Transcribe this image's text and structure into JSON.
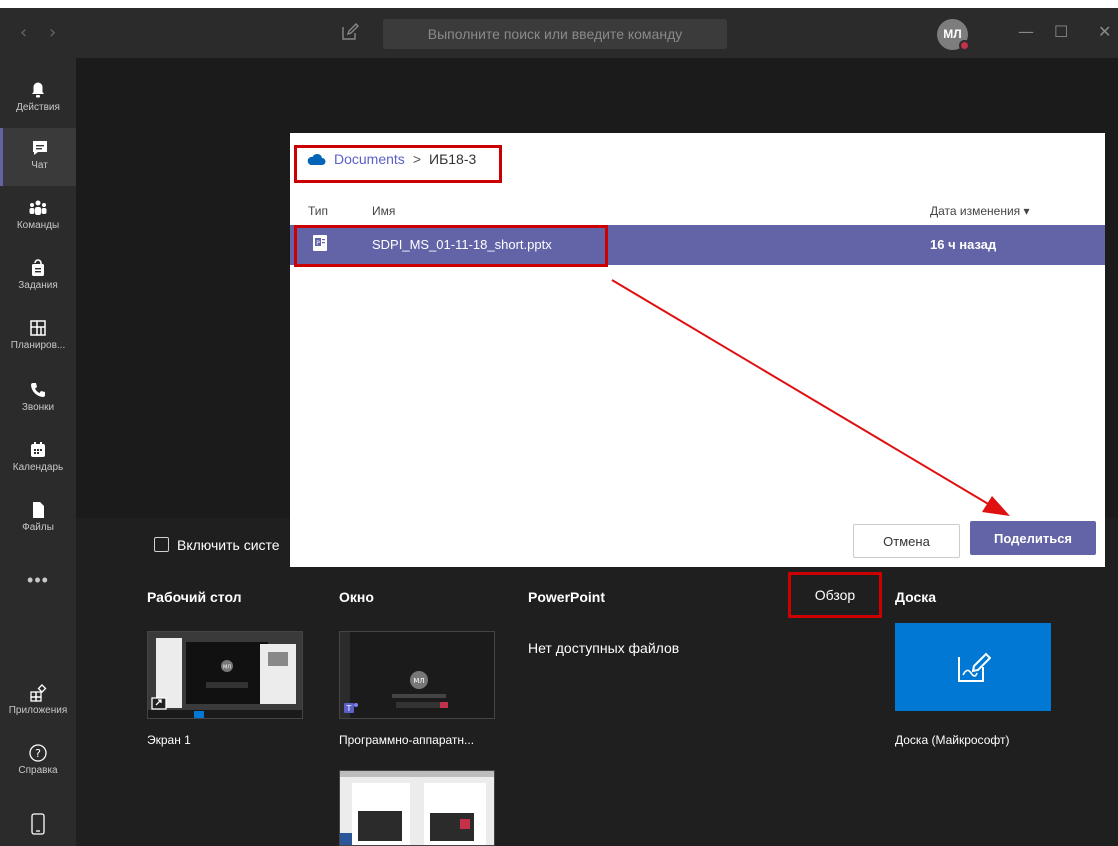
{
  "titlebar": {
    "back": "‹",
    "forward": "›",
    "search_placeholder": "Выполните поиск или введите команду",
    "avatar_initials": "МЛ",
    "minimize": "—",
    "maximize": "☐",
    "close": "✕"
  },
  "rail": {
    "items": [
      {
        "label": "Действия",
        "icon": "bell-icon"
      },
      {
        "label": "Чат",
        "icon": "chat-icon"
      },
      {
        "label": "Команды",
        "icon": "teams-icon"
      },
      {
        "label": "Задания",
        "icon": "assignments-icon"
      },
      {
        "label": "Планиров...",
        "icon": "planner-icon"
      },
      {
        "label": "Звонки",
        "icon": "phone-icon"
      },
      {
        "label": "Календарь",
        "icon": "calendar-icon"
      },
      {
        "label": "Файлы",
        "icon": "file-icon"
      },
      {
        "label": "Приложения",
        "icon": "apps-icon"
      },
      {
        "label": "Справка",
        "icon": "help-icon"
      }
    ],
    "more": "•••"
  },
  "share_tray": {
    "system_audio_label": "Включить систе",
    "columns": {
      "desktop": "Рабочий стол",
      "window": "Окно",
      "powerpoint": "PowerPoint",
      "browse": "Обзор",
      "whiteboard": "Доска"
    },
    "no_files": "Нет доступных файлов",
    "desktop_thumb_label": "Экран 1",
    "window_thumb_label": "Программно-аппаратн...",
    "whiteboard_label": "Доска (Майкрософт)",
    "thumb_avatar": "МЛ"
  },
  "dialog": {
    "breadcrumb": {
      "root": "Documents",
      "separator": ">",
      "current": "ИБ18-3"
    },
    "columns": {
      "type": "Тип",
      "name": "Имя",
      "modified": "Дата изменения ▾"
    },
    "files": [
      {
        "name": "SDPI_MS_01-11-18_short.pptx",
        "modified": "16 ч назад"
      }
    ],
    "cancel": "Отмена",
    "share": "Поделиться"
  },
  "colors": {
    "accent": "#6264a7",
    "highlight": "#cc0000",
    "whiteboard": "#0078d4"
  }
}
